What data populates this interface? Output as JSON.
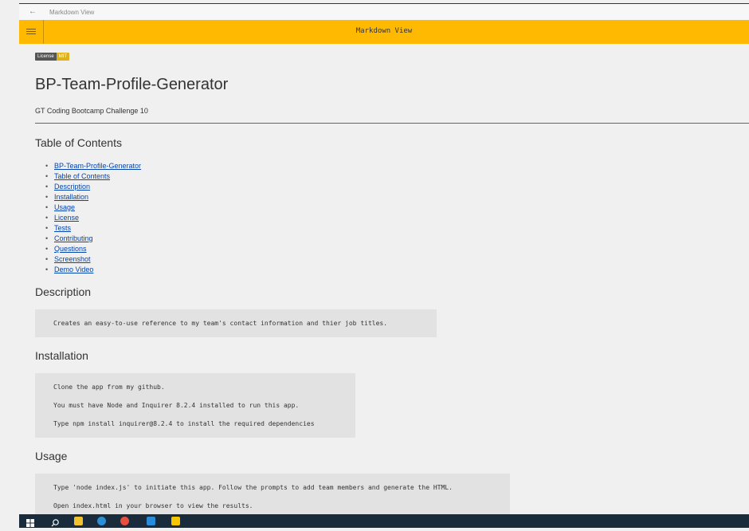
{
  "window": {
    "title": "Markdown View",
    "back_glyph": "←"
  },
  "appbar": {
    "title": "Markdown View",
    "menu_icon": "hamburger-icon"
  },
  "badge": {
    "label": "License",
    "value": "MIT"
  },
  "doc": {
    "title": "BP-Team-Profile-Generator",
    "subtitle": "GT Coding Bootcamp Challenge 10",
    "toc_heading": "Table of Contents",
    "toc": [
      "BP-Team-Profile-Generator",
      "Table of Contents",
      "Description",
      "Installation",
      "Usage",
      "License",
      "Tests",
      "Contributing",
      "Questions",
      "Screenshot",
      "Demo Video"
    ],
    "description_heading": "Description",
    "description_lines": [
      "Creates an easy-to-use reference to my team's contact information and thier job titles."
    ],
    "installation_heading": "Installation",
    "installation_lines": [
      "Clone the app from my github.",
      "You must have Node and Inquirer 8.2.4 installed to run this app.",
      "Type npm install inquirer@8.2.4 to install the required dependencies"
    ],
    "usage_heading": "Usage",
    "usage_lines": [
      "Type 'node index.js' to initiate this app. Follow the prompts to add team members and generate the HTML.",
      "Open index.html in your browser to view the results."
    ]
  },
  "taskbar": {
    "icons": [
      "windows-start-icon",
      "search-icon",
      "file-explorer-icon",
      "edge-browser-icon",
      "chrome-browser-icon",
      "vscode-icon",
      "sticky-notes-icon"
    ],
    "colors": {
      "background": "#1a2b3c",
      "start": "#ffffff",
      "explorer": "#f2c12e",
      "edge": "#2b8fd6",
      "chrome": "#e84f3d",
      "vscode": "#2a8bd8",
      "sticky": "#f6c600"
    }
  },
  "colors": {
    "accent": "#ffb900",
    "link": "#0645ad",
    "code_bg": "#e2e2e2",
    "page_bg": "#f0f0f0"
  }
}
